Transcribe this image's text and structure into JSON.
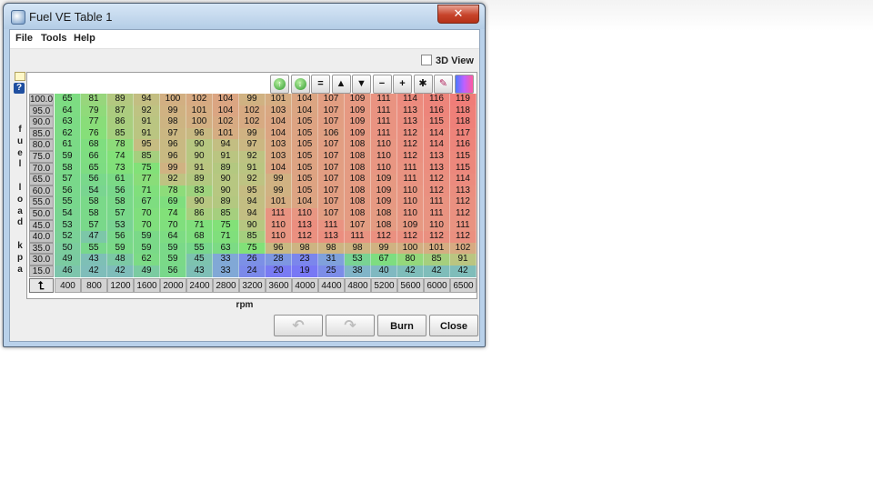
{
  "window": {
    "title": "Fuel VE Table 1",
    "close_glyph": "✕"
  },
  "menu": {
    "file": "File",
    "tools": "Tools",
    "help": "Help"
  },
  "view3d_label": "3D View",
  "side_tools": {
    "help_glyph": "?"
  },
  "toolbar": [
    {
      "name": "increase-icon",
      "glyph": "↑"
    },
    {
      "name": "decrease-icon",
      "glyph": "↓"
    },
    {
      "name": "equals-button",
      "glyph": "="
    },
    {
      "name": "up-button",
      "glyph": "▲"
    },
    {
      "name": "down-button",
      "glyph": "▼"
    },
    {
      "name": "minus-button",
      "glyph": "−"
    },
    {
      "name": "plus-button",
      "glyph": "+"
    },
    {
      "name": "multiply-button",
      "glyph": "✱"
    },
    {
      "name": "pencil-icon",
      "glyph": "✎"
    },
    {
      "name": "color-scale-icon",
      "glyph": ""
    }
  ],
  "axis": {
    "y_label": "fuel load kpa",
    "x_label": "rpm"
  },
  "table": {
    "rows": [
      "100.0",
      "95.0",
      "90.0",
      "85.0",
      "80.0",
      "75.0",
      "70.0",
      "65.0",
      "60.0",
      "55.0",
      "50.0",
      "45.0",
      "40.0",
      "35.0",
      "30.0",
      "15.0"
    ],
    "cols": [
      "400",
      "800",
      "1200",
      "1600",
      "2000",
      "2400",
      "2800",
      "3200",
      "3600",
      "4000",
      "4400",
      "4800",
      "5200",
      "5600",
      "6000",
      "6500"
    ],
    "values": [
      [
        65,
        81,
        89,
        94,
        100,
        102,
        104,
        99,
        101,
        104,
        107,
        109,
        111,
        114,
        116,
        119
      ],
      [
        64,
        79,
        87,
        92,
        99,
        101,
        104,
        102,
        103,
        104,
        107,
        109,
        111,
        113,
        116,
        118
      ],
      [
        63,
        77,
        86,
        91,
        98,
        100,
        102,
        102,
        104,
        105,
        107,
        109,
        111,
        113,
        115,
        118
      ],
      [
        62,
        76,
        85,
        91,
        97,
        96,
        101,
        99,
        104,
        105,
        106,
        109,
        111,
        112,
        114,
        117
      ],
      [
        61,
        68,
        78,
        95,
        96,
        90,
        94,
        97,
        103,
        105,
        107,
        108,
        110,
        112,
        114,
        116
      ],
      [
        59,
        66,
        74,
        85,
        96,
        90,
        91,
        92,
        103,
        105,
        107,
        108,
        110,
        112,
        113,
        115
      ],
      [
        58,
        65,
        73,
        75,
        99,
        91,
        89,
        91,
        104,
        105,
        107,
        108,
        110,
        111,
        113,
        115
      ],
      [
        57,
        56,
        61,
        77,
        92,
        89,
        90,
        92,
        99,
        105,
        107,
        108,
        109,
        111,
        112,
        114
      ],
      [
        56,
        54,
        56,
        71,
        78,
        83,
        90,
        95,
        99,
        105,
        107,
        108,
        109,
        110,
        112,
        113
      ],
      [
        55,
        58,
        58,
        67,
        69,
        90,
        89,
        94,
        101,
        104,
        107,
        108,
        109,
        110,
        111,
        112
      ],
      [
        54,
        58,
        57,
        70,
        74,
        86,
        85,
        94,
        111,
        110,
        107,
        108,
        108,
        110,
        111,
        112
      ],
      [
        53,
        57,
        53,
        70,
        70,
        71,
        75,
        90,
        110,
        113,
        111,
        107,
        108,
        109,
        110,
        111
      ],
      [
        52,
        47,
        56,
        59,
        64,
        68,
        71,
        85,
        110,
        112,
        113,
        111,
        112,
        112,
        112,
        112
      ],
      [
        50,
        55,
        59,
        59,
        59,
        55,
        63,
        75,
        96,
        98,
        98,
        98,
        99,
        100,
        101,
        102
      ],
      [
        49,
        43,
        48,
        62,
        59,
        45,
        33,
        26,
        28,
        23,
        31,
        53,
        67,
        80,
        85,
        91
      ],
      [
        46,
        42,
        42,
        49,
        56,
        43,
        33,
        24,
        20,
        19,
        25,
        38,
        40,
        42,
        42,
        42
      ]
    ]
  },
  "buttons": {
    "undo_glyph": "↶",
    "redo_glyph": "↷",
    "burn": "Burn",
    "close": "Close"
  }
}
